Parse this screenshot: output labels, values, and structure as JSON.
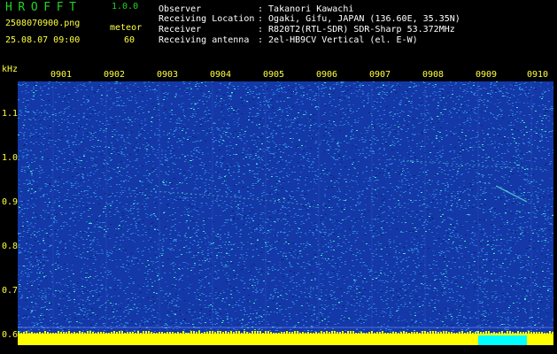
{
  "header": {
    "app_name": "HROFFT",
    "version": "1.0.0",
    "filename": "2508070900.png",
    "datetime": "25.08.07 09:00",
    "meteor_label": "meteor",
    "meteor_count": "60"
  },
  "info": {
    "observer_label": "Observer",
    "observer_value": ": Takanori Kawachi",
    "location_label": "Receiving Location",
    "location_value": ": Ogaki, Gifu, JAPAN (136.60E, 35.35N)",
    "receiver_label": "Receiver",
    "receiver_value": ": R820T2(RTL-SDR) SDR-Sharp 53.372MHz",
    "antenna_label": "Receiving antenna",
    "antenna_value": ": 2el-HB9CV Vertical (el. E-W)"
  },
  "axes": {
    "y_unit": "kHz",
    "y_ticks": [
      "1.1",
      "1.0",
      "0.9",
      "0.8",
      "0.7",
      "0.6"
    ],
    "x_ticks": [
      "0901",
      "0902",
      "0903",
      "0904",
      "0905",
      "0906",
      "0907",
      "0908",
      "0909",
      "0910"
    ]
  },
  "colors": {
    "background": "#000000",
    "spectrogram_base": "#1438a8",
    "noise_light": "#2a86d8",
    "noise_hot": "#40e8c0",
    "label_yellow": "#ffff40",
    "logo_green": "#23d423",
    "baseline_yellow": "#ffff00",
    "baseline_cyan": "#00ffff"
  }
}
